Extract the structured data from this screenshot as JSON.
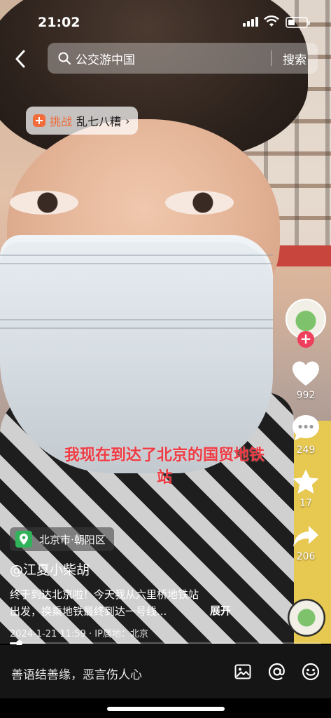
{
  "status_bar": {
    "time": "21:02"
  },
  "search": {
    "query": "公交游中国",
    "button": "搜索"
  },
  "challenge": {
    "label": "挑战",
    "title": "乱七八糟",
    "chevron": "›"
  },
  "actions": {
    "like_count": "992",
    "comment_count": "249",
    "favorite_count": "17",
    "share_count": "206"
  },
  "subtitle": {
    "line1": "我现在到达了北京的国贸地铁",
    "line2": "站"
  },
  "location": {
    "text": "北京市·朝阳区"
  },
  "post": {
    "author": "@江夏小柴胡",
    "description_line1": "终于到达北京啦！今天我从六里桥地铁站",
    "description_line2": "出发，换乘地铁最终到达一号线...",
    "expand": "展开",
    "meta": "2024-1-21 11:59 · IP属地：北京"
  },
  "playback": {
    "progress_fraction": 0.03
  },
  "comment_bar": {
    "placeholder": "善语结善缘，恶言伤人心"
  },
  "icons": [
    "back-icon",
    "search-icon",
    "challenge-icon",
    "heart-icon",
    "comment-icon",
    "star-icon",
    "share-icon",
    "location-pin-icon",
    "image-icon",
    "at-icon",
    "emoji-icon"
  ],
  "colors": {
    "accent": "#f26b3a",
    "follow": "#ee3f5c",
    "subtitle": "#ef3b43",
    "location_pin": "#30b35a"
  }
}
